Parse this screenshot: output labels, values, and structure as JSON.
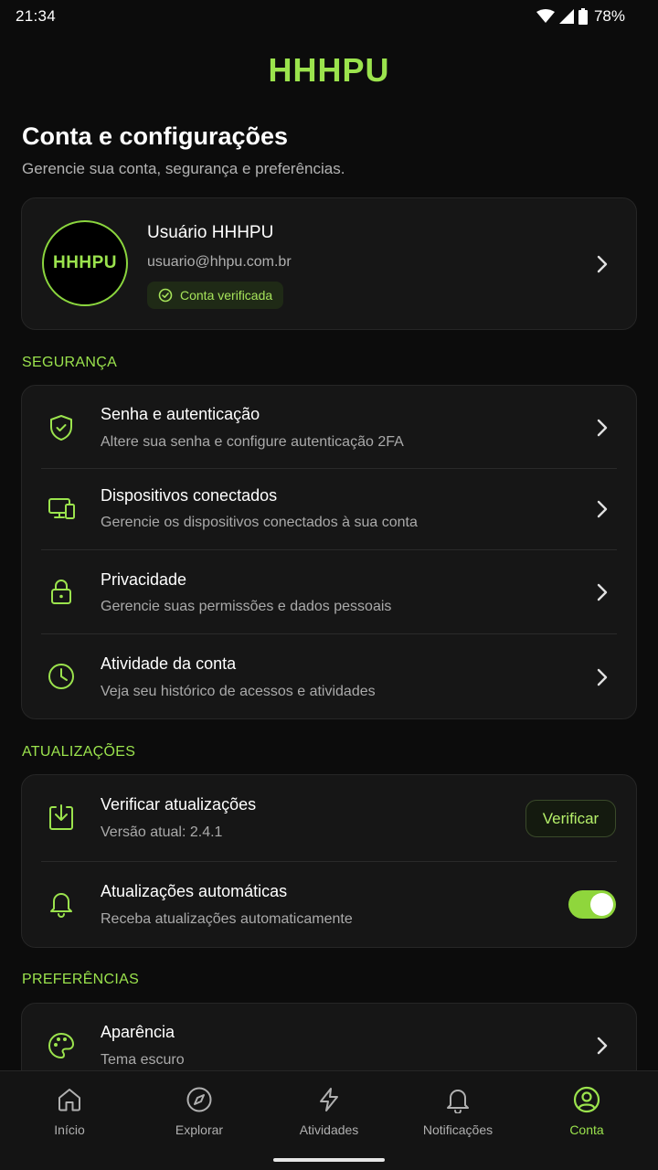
{
  "status_bar": {
    "time": "21:34",
    "battery": "78%"
  },
  "brand": "HHHPU",
  "page": {
    "title": "Conta e configurações",
    "subtitle": "Gerencie sua conta, segurança e preferências."
  },
  "profile": {
    "avatar_text": "HHHPU",
    "name": "Usuário HHHPU",
    "email": "usuario@hhpu.com.br",
    "badge": "Conta verificada"
  },
  "security": {
    "label": "SEGURANÇA",
    "items": [
      {
        "icon": "shield-check-icon",
        "title": "Senha e autenticação",
        "subtitle": "Altere sua senha e configure autenticação 2FA"
      },
      {
        "icon": "devices-icon",
        "title": "Dispositivos conectados",
        "subtitle": "Gerencie os dispositivos conectados à sua conta"
      },
      {
        "icon": "lock-icon",
        "title": "Privacidade",
        "subtitle": "Gerencie suas permissões e dados pessoais"
      },
      {
        "icon": "clock-icon",
        "title": "Atividade da conta",
        "subtitle": "Veja seu histórico de acessos e atividades"
      }
    ]
  },
  "updates": {
    "label": "ATUALIZAÇÕES",
    "check": {
      "title": "Verificar atualizações",
      "subtitle": "Versão atual: 2.4.1",
      "button": "Verificar"
    },
    "auto": {
      "title": "Atualizações automáticas",
      "subtitle": "Receba atualizações automaticamente",
      "enabled": true
    }
  },
  "preferences": {
    "label": "PREFERÊNCIAS",
    "items": [
      {
        "icon": "palette-icon",
        "title": "Aparência",
        "subtitle": "Tema escuro"
      }
    ]
  },
  "nav": {
    "items": [
      {
        "label": "Início",
        "icon": "home-icon"
      },
      {
        "label": "Explorar",
        "icon": "compass-icon"
      },
      {
        "label": "Atividades",
        "icon": "lightning-icon"
      },
      {
        "label": "Notificações",
        "icon": "bell-icon"
      },
      {
        "label": "Conta",
        "icon": "user-circle-icon",
        "active": true
      }
    ]
  },
  "colors": {
    "accent": "#9be34d",
    "background": "#0c0c0c",
    "card": "#161616"
  }
}
